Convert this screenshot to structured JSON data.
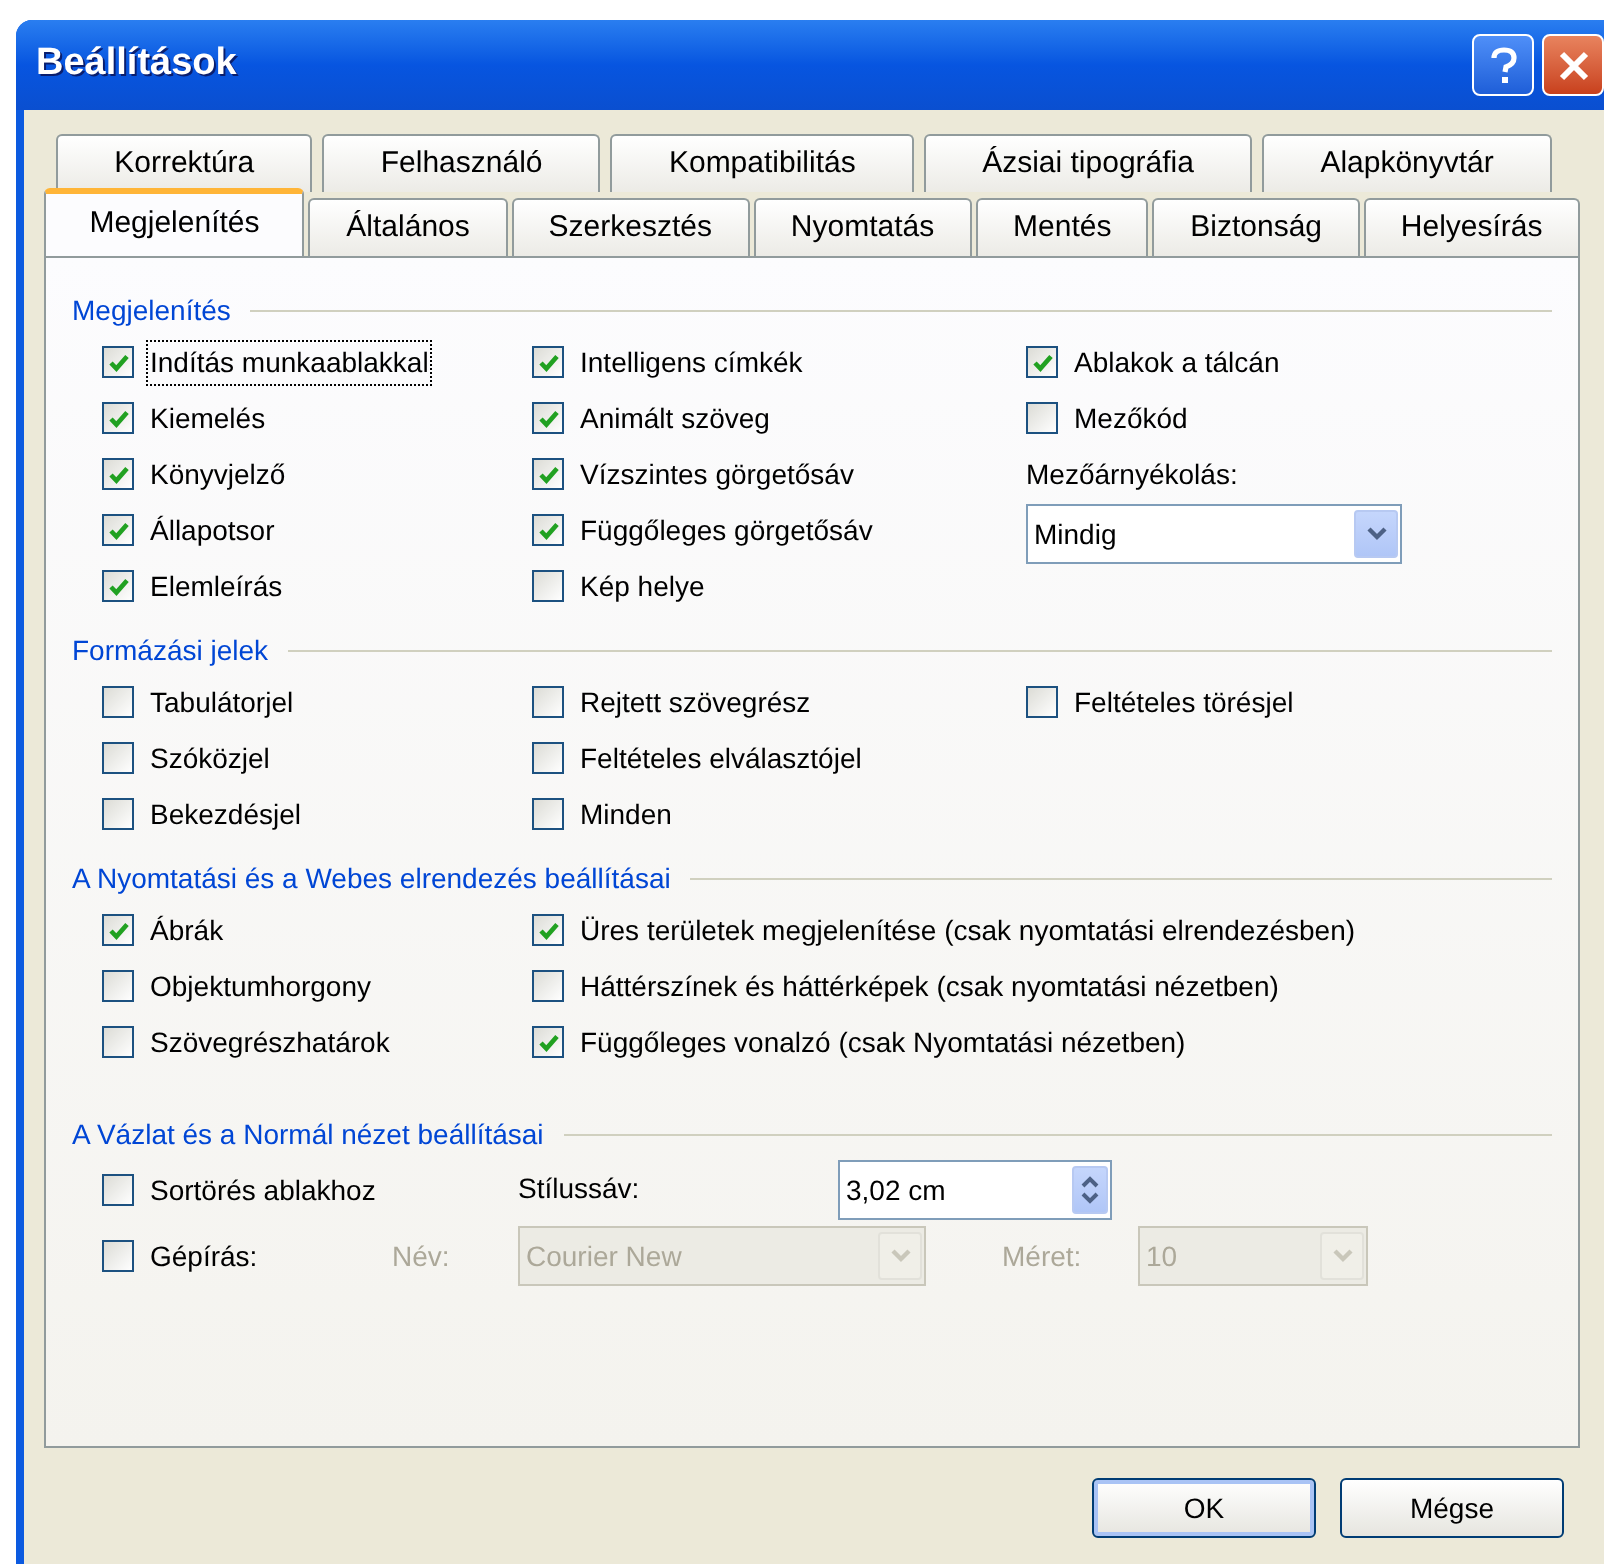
{
  "window": {
    "title": "Beállítások"
  },
  "tab_rows": [
    [
      {
        "label": "Korrektúra",
        "selected": false
      },
      {
        "label": "Felhasználó",
        "selected": false
      },
      {
        "label": "Kompatibilitás",
        "selected": false
      },
      {
        "label": "Ázsiai tipográfia",
        "selected": false
      },
      {
        "label": "Alapkönyvtár",
        "selected": false
      }
    ],
    [
      {
        "label": "Megjelenítés",
        "selected": true
      },
      {
        "label": "Általános",
        "selected": false
      },
      {
        "label": "Szerkesztés",
        "selected": false
      },
      {
        "label": "Nyomtatás",
        "selected": false
      },
      {
        "label": "Mentés",
        "selected": false
      },
      {
        "label": "Biztonság",
        "selected": false
      },
      {
        "label": "Helyesírás",
        "selected": false
      }
    ]
  ],
  "sections": [
    {
      "title": "Megjelenítés",
      "kind": "columns",
      "columns": [
        [
          {
            "kind": "checkbox",
            "label": "Indítás munkaablakkal",
            "checked": true,
            "focused": true
          },
          {
            "kind": "checkbox",
            "label": "Kiemelés",
            "checked": true
          },
          {
            "kind": "checkbox",
            "label": "Könyvjelző",
            "checked": true
          },
          {
            "kind": "checkbox",
            "label": "Állapotsor",
            "checked": true
          },
          {
            "kind": "checkbox",
            "label": "Elemleírás",
            "checked": true
          }
        ],
        [
          {
            "kind": "checkbox",
            "label": "Intelligens címkék",
            "checked": true
          },
          {
            "kind": "checkbox",
            "label": "Animált szöveg",
            "checked": true
          },
          {
            "kind": "checkbox",
            "label": "Vízszintes görgetősáv",
            "checked": true
          },
          {
            "kind": "checkbox",
            "label": "Függőleges görgetősáv",
            "checked": true
          },
          {
            "kind": "checkbox",
            "label": "Kép helye",
            "checked": false
          }
        ],
        [
          {
            "kind": "checkbox",
            "label": "Ablakok a tálcán",
            "checked": true
          },
          {
            "kind": "checkbox",
            "label": "Mezőkód",
            "checked": false
          },
          {
            "kind": "label",
            "text": "Mezőárnyékolás:",
            "disabled": false
          },
          {
            "kind": "dropdown",
            "value": "Mindig",
            "disabled": false
          }
        ]
      ]
    },
    {
      "title": "Formázási jelek",
      "kind": "columns",
      "columns": [
        [
          {
            "kind": "checkbox",
            "label": "Tabulátorjel",
            "checked": false
          },
          {
            "kind": "checkbox",
            "label": "Szóközjel",
            "checked": false
          },
          {
            "kind": "checkbox",
            "label": "Bekezdésjel",
            "checked": false
          }
        ],
        [
          {
            "kind": "checkbox",
            "label": "Rejtett szövegrész",
            "checked": false
          },
          {
            "kind": "checkbox",
            "label": "Feltételes elválasztójel",
            "checked": false
          },
          {
            "kind": "checkbox",
            "label": "Minden",
            "checked": false
          }
        ],
        [
          {
            "kind": "checkbox",
            "label": "Feltételes törésjel",
            "checked": false
          }
        ]
      ]
    },
    {
      "title": "A Nyomtatási és a Webes elrendezés beállításai",
      "kind": "columns",
      "columns": [
        [
          {
            "kind": "checkbox",
            "label": "Ábrák",
            "checked": true
          },
          {
            "kind": "checkbox",
            "label": "Objektumhorgony",
            "checked": false
          },
          {
            "kind": "checkbox",
            "label": "Szövegrészhatárok",
            "checked": false
          }
        ],
        [
          {
            "kind": "checkbox",
            "label": "Üres területek megjelenítése (csak nyomtatási elrendezésben)",
            "checked": true
          },
          {
            "kind": "checkbox",
            "label": "Háttérszínek és háttérképek (csak nyomtatási nézetben)",
            "checked": false
          },
          {
            "kind": "checkbox",
            "label": "Függőleges vonalzó (csak Nyomtatási nézetben)",
            "checked": true
          }
        ]
      ]
    },
    {
      "title": "A Vázlat és a Normál nézet beállításai",
      "kind": "form",
      "wrap_to_window": {
        "label": "Sortörés ablakhoz",
        "checked": false
      },
      "style_area": {
        "label": "Stílussáv:",
        "value": "3,02 cm"
      },
      "draft_font": {
        "label": "Gépírás:",
        "checked": false
      },
      "font_name": {
        "label": "Név:",
        "value": "Courier New",
        "disabled": true
      },
      "font_size": {
        "label": "Méret:",
        "value": "10",
        "disabled": true
      }
    }
  ],
  "buttons": [
    "OK",
    "Mégse"
  ]
}
